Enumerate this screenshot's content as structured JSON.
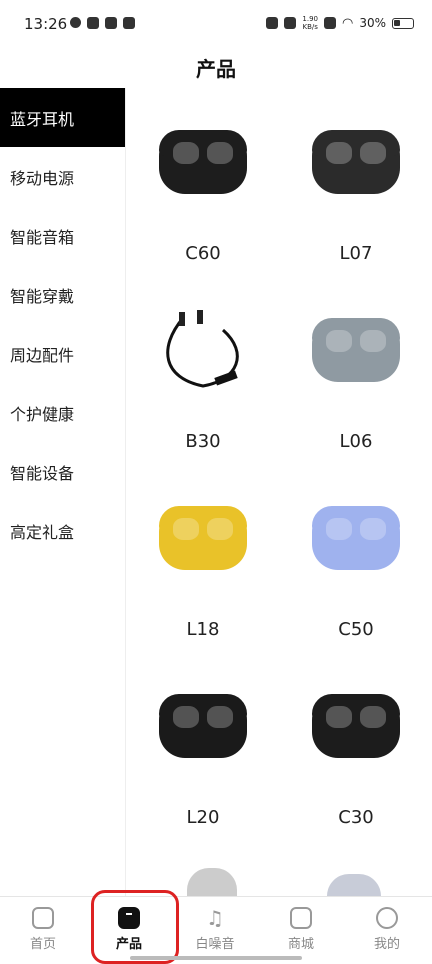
{
  "status": {
    "time": "13:26",
    "net_speed_top": "1.90",
    "net_speed_bottom": "KB/s",
    "battery": "30%"
  },
  "header": {
    "title": "产品"
  },
  "sidebar": {
    "items": [
      {
        "label": "蓝牙耳机",
        "active": true
      },
      {
        "label": "移动电源"
      },
      {
        "label": "智能音箱"
      },
      {
        "label": "智能穿戴"
      },
      {
        "label": "周边配件"
      },
      {
        "label": "个护健康"
      },
      {
        "label": "智能设备"
      },
      {
        "label": "高定礼盒"
      }
    ]
  },
  "products": [
    {
      "name": "C60",
      "color": "#1d1d1d"
    },
    {
      "name": "L07",
      "color": "#2b2b2b"
    },
    {
      "name": "B30",
      "color": "#111111"
    },
    {
      "name": "L06",
      "color": "#8f9aa2"
    },
    {
      "name": "L18",
      "color": "#e9c229"
    },
    {
      "name": "C50",
      "color": "#9fb2ee"
    },
    {
      "name": "L20",
      "color": "#1a1a1a"
    },
    {
      "name": "C30",
      "color": "#1c1c1c"
    }
  ],
  "bottom_nav": [
    {
      "label": "首页",
      "icon": "home-icon"
    },
    {
      "label": "产品",
      "icon": "product-icon",
      "active": true
    },
    {
      "label": "白噪音",
      "icon": "music-note-icon"
    },
    {
      "label": "商城",
      "icon": "store-icon"
    },
    {
      "label": "我的",
      "icon": "profile-smile-icon"
    }
  ]
}
